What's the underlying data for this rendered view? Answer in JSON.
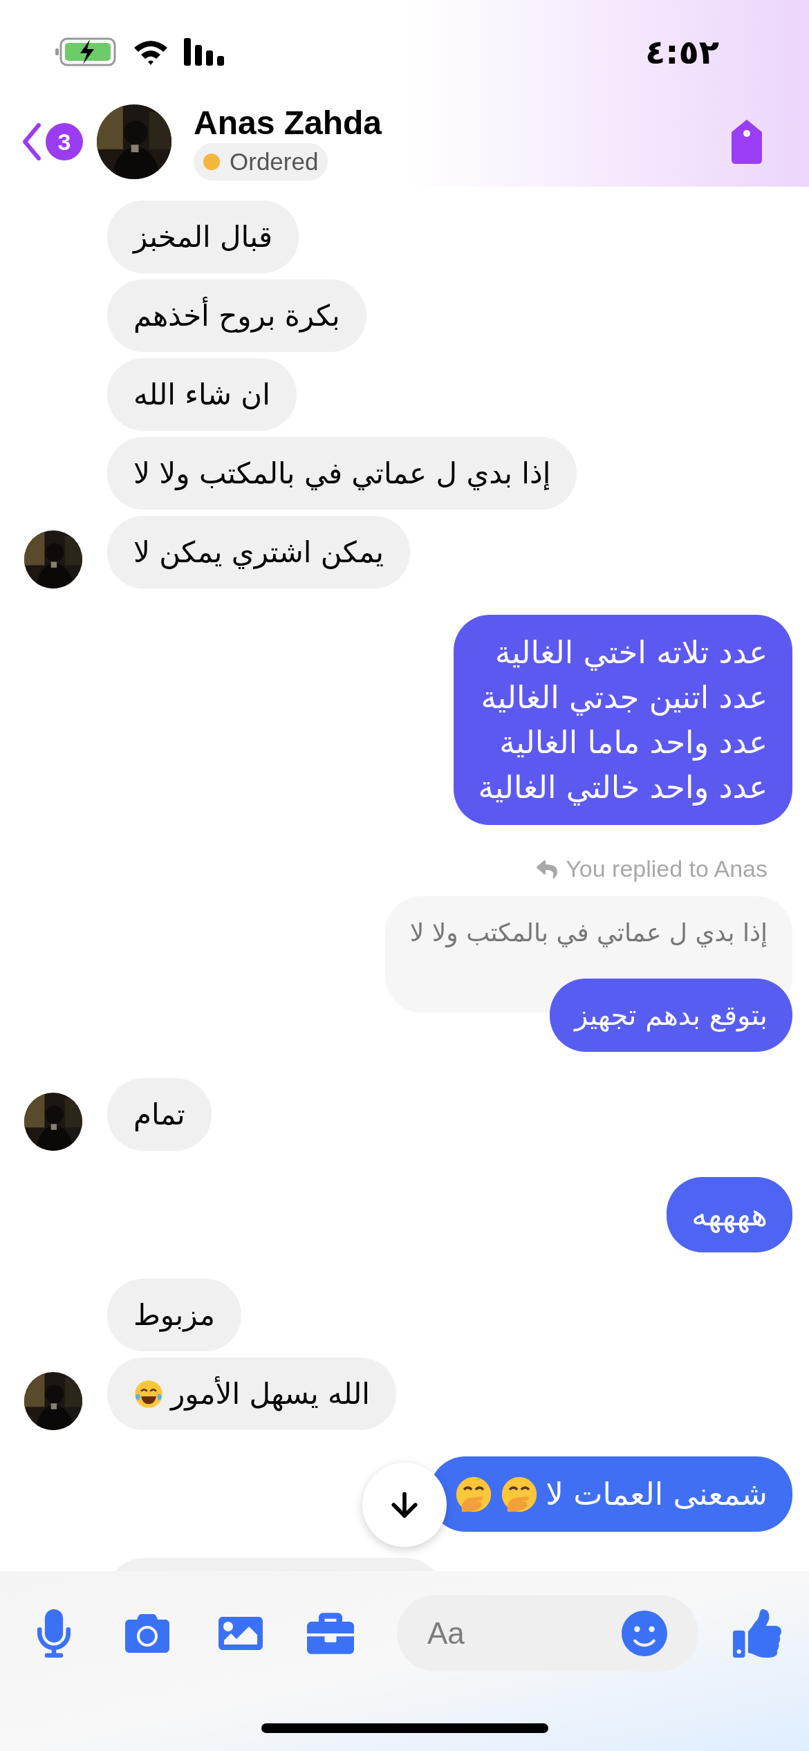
{
  "status_bar": {
    "time": "٤:٥٢"
  },
  "header": {
    "unread_count": "3",
    "name": "Anas Zahda",
    "status": {
      "label": "Ordered",
      "color": "#f5b63c"
    }
  },
  "messages": [
    {
      "kind": "incoming",
      "text": "قبال المخبز",
      "avatar": false
    },
    {
      "kind": "incoming",
      "text": "بكرة بروح أخذهم",
      "avatar": false
    },
    {
      "kind": "incoming",
      "text": "ان شاء الله",
      "avatar": false
    },
    {
      "kind": "incoming",
      "text": "إذا بدي ل عماتي في بالمكتب ولا لا",
      "avatar": false
    },
    {
      "kind": "incoming",
      "text": "يمكن اشتري يمكن لا",
      "avatar": true
    },
    {
      "kind": "outgoing",
      "lines": [
        "عدد تلاته اختي الغالية",
        "عدد اتنين جدتي الغالية",
        "عدد واحد ماما الغالية",
        "عدد واحد خالتي الغالية"
      ]
    },
    {
      "kind": "reply",
      "label": "You replied to Anas",
      "quoted": "إذا بدي ل عماتي في بالمكتب ولا لا",
      "text": "بتوقع بدهم تجهيز"
    },
    {
      "kind": "incoming",
      "text": "تمام",
      "avatar": true
    },
    {
      "kind": "outgoing",
      "lines": [
        "ههههه"
      ]
    },
    {
      "kind": "incoming",
      "text": "مزبوط",
      "avatar": false
    },
    {
      "kind": "incoming",
      "text": "الله يسهل الأمور",
      "emojis": [
        {
          "kind": "tears_of_joy"
        }
      ],
      "avatar": true
    },
    {
      "kind": "outgoing",
      "lines": [
        "شمعنى العمات لا"
      ],
      "emojis": [
        {
          "kind": "hand_over_mouth"
        },
        {
          "kind": "hand_over_mouth"
        }
      ]
    },
    {
      "kind": "incoming",
      "avatar": false
    }
  ],
  "composer": {
    "placeholder": "Aa"
  }
}
